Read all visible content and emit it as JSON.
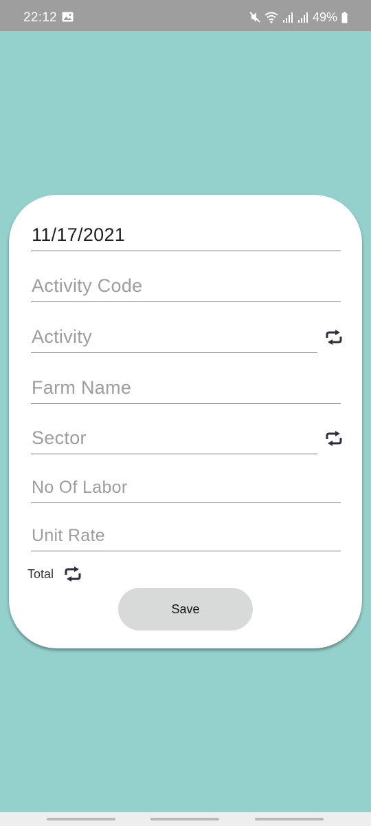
{
  "status_bar": {
    "time": "22:12",
    "battery": "49%"
  },
  "form": {
    "date_value": "11/17/2021",
    "activity_code_placeholder": "Activity Code",
    "activity_placeholder": "Activity",
    "farm_name_placeholder": "Farm Name",
    "sector_placeholder": "Sector",
    "no_of_labor_placeholder": "No Of Labor",
    "unit_rate_placeholder": "Unit Rate",
    "total_label": "Total",
    "save_label": "Save"
  },
  "icons": {
    "refresh": "refresh-icon",
    "mute": "mute-icon",
    "wifi": "wifi-icon",
    "signal": "signal-icon",
    "battery": "battery-icon",
    "gallery": "gallery-icon"
  },
  "colors": {
    "background": "#94d0cc",
    "status_bar": "#9e9e9e",
    "card": "#ffffff",
    "button": "#d8d9d9",
    "icon": "#2b2f3a"
  }
}
